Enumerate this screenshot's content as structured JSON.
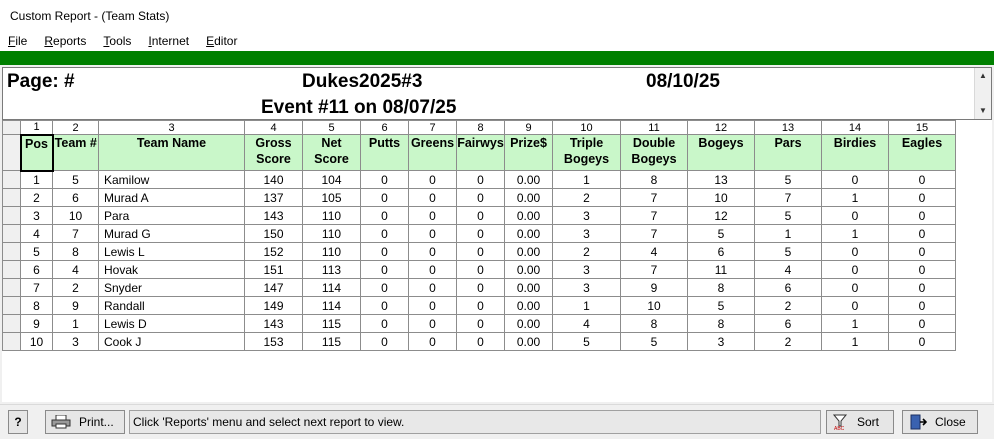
{
  "window": {
    "title": "Custom Report - (Team Stats)"
  },
  "menu": [
    {
      "key": "F",
      "rest": "ile"
    },
    {
      "key": "R",
      "rest": "eports"
    },
    {
      "key": "T",
      "rest": "ools"
    },
    {
      "key": "I",
      "rest": "nternet"
    },
    {
      "key": "E",
      "rest": "ditor"
    }
  ],
  "report_header": {
    "page": "Page: #",
    "league": "Dukes2025#3",
    "date": "08/10/25",
    "event": "Event #11 on 08/07/25"
  },
  "table": {
    "column_numbers": [
      "1",
      "2",
      "3",
      "4",
      "5",
      "6",
      "7",
      "8",
      "9",
      "10",
      "11",
      "12",
      "13",
      "14",
      "15"
    ],
    "headers": [
      "Pos",
      "Team #",
      "Team Name",
      "Gross Score",
      "Net Score",
      "Putts",
      "Greens",
      "Fairwys",
      "Prize$",
      "Triple Bogeys",
      "Double Bogeys",
      "Bogeys",
      "Pars",
      "Birdies",
      "Eagles"
    ],
    "rows": [
      [
        "1",
        "5",
        "Kamilow",
        "140",
        "104",
        "0",
        "0",
        "0",
        "0.00",
        "1",
        "8",
        "13",
        "5",
        "0",
        "0"
      ],
      [
        "2",
        "6",
        "Murad A",
        "137",
        "105",
        "0",
        "0",
        "0",
        "0.00",
        "2",
        "7",
        "10",
        "7",
        "1",
        "0"
      ],
      [
        "3",
        "10",
        "Para",
        "143",
        "110",
        "0",
        "0",
        "0",
        "0.00",
        "3",
        "7",
        "12",
        "5",
        "0",
        "0"
      ],
      [
        "4",
        "7",
        "Murad G",
        "150",
        "110",
        "0",
        "0",
        "0",
        "0.00",
        "3",
        "7",
        "5",
        "1",
        "1",
        "0"
      ],
      [
        "5",
        "8",
        "Lewis L",
        "152",
        "110",
        "0",
        "0",
        "0",
        "0.00",
        "2",
        "4",
        "6",
        "5",
        "0",
        "0"
      ],
      [
        "6",
        "4",
        "Hovak",
        "151",
        "113",
        "0",
        "0",
        "0",
        "0.00",
        "3",
        "7",
        "11",
        "4",
        "0",
        "0"
      ],
      [
        "7",
        "2",
        "Snyder",
        "147",
        "114",
        "0",
        "0",
        "0",
        "0.00",
        "3",
        "9",
        "8",
        "6",
        "0",
        "0"
      ],
      [
        "8",
        "9",
        "Randall",
        "149",
        "114",
        "0",
        "0",
        "0",
        "0.00",
        "1",
        "10",
        "5",
        "2",
        "0",
        "0"
      ],
      [
        "9",
        "1",
        "Lewis D",
        "143",
        "115",
        "0",
        "0",
        "0",
        "0.00",
        "4",
        "8",
        "8",
        "6",
        "1",
        "0"
      ],
      [
        "10",
        "3",
        "Cook J",
        "153",
        "115",
        "0",
        "0",
        "0",
        "0.00",
        "5",
        "5",
        "3",
        "2",
        "1",
        "0"
      ]
    ]
  },
  "statusbar": {
    "help_label": "?",
    "print_label": "Print...",
    "message": "Click 'Reports' menu and select next report to view.",
    "sort_label": "Sort",
    "close_label": "Close"
  },
  "colors": {
    "accent_green": "#008000",
    "header_fill": "#c9f7c9"
  },
  "icons": [
    "printer-icon",
    "sort-filter-icon",
    "exit-door-icon",
    "scroll-up-icon",
    "scroll-down-icon"
  ]
}
